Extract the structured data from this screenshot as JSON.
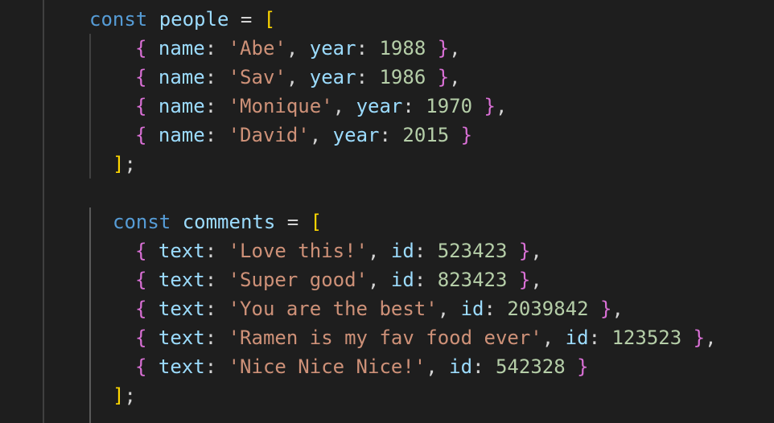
{
  "window": {
    "app": "code-editor",
    "language": "javascript"
  },
  "colors": {
    "background": "#1e1e1e",
    "keyword": "#569cd6",
    "variable": "#9cdcfe",
    "string": "#ce9178",
    "number": "#b5cea8",
    "punctuation": "#d4d4d4",
    "bracket_level_1": "#ffd700",
    "bracket_level_2": "#da70d6",
    "indent_guide": "#404040"
  },
  "code": {
    "people": {
      "keyword": "const",
      "name": "people",
      "assign": "=",
      "open": "[",
      "close": "]",
      "terminator": ";",
      "items": [
        {
          "key1": "name",
          "val1": "'Abe'",
          "key2": "year",
          "val2": "1988",
          "trail": ","
        },
        {
          "key1": "name",
          "val1": "'Sav'",
          "key2": "year",
          "val2": "1986",
          "trail": ","
        },
        {
          "key1": "name",
          "val1": "'Monique'",
          "key2": "year",
          "val2": "1970",
          "trail": ","
        },
        {
          "key1": "name",
          "val1": "'David'",
          "key2": "year",
          "val2": "2015",
          "trail": ""
        }
      ]
    },
    "comments": {
      "keyword": "const",
      "name": "comments",
      "assign": "=",
      "open": "[",
      "close": "]",
      "terminator": ";",
      "items": [
        {
          "key1": "text",
          "val1": "'Love this!'",
          "key2": "id",
          "val2": "523423",
          "trail": ","
        },
        {
          "key1": "text",
          "val1": "'Super good'",
          "key2": "id",
          "val2": "823423",
          "trail": ","
        },
        {
          "key1": "text",
          "val1": "'You are the best'",
          "key2": "id",
          "val2": "2039842",
          "trail": ","
        },
        {
          "key1": "text",
          "val1": "'Ramen is my fav food ever'",
          "key2": "id",
          "val2": "123523",
          "trail": ","
        },
        {
          "key1": "text",
          "val1": "'Nice Nice Nice!'",
          "key2": "id",
          "val2": "542328",
          "trail": ""
        }
      ]
    }
  }
}
